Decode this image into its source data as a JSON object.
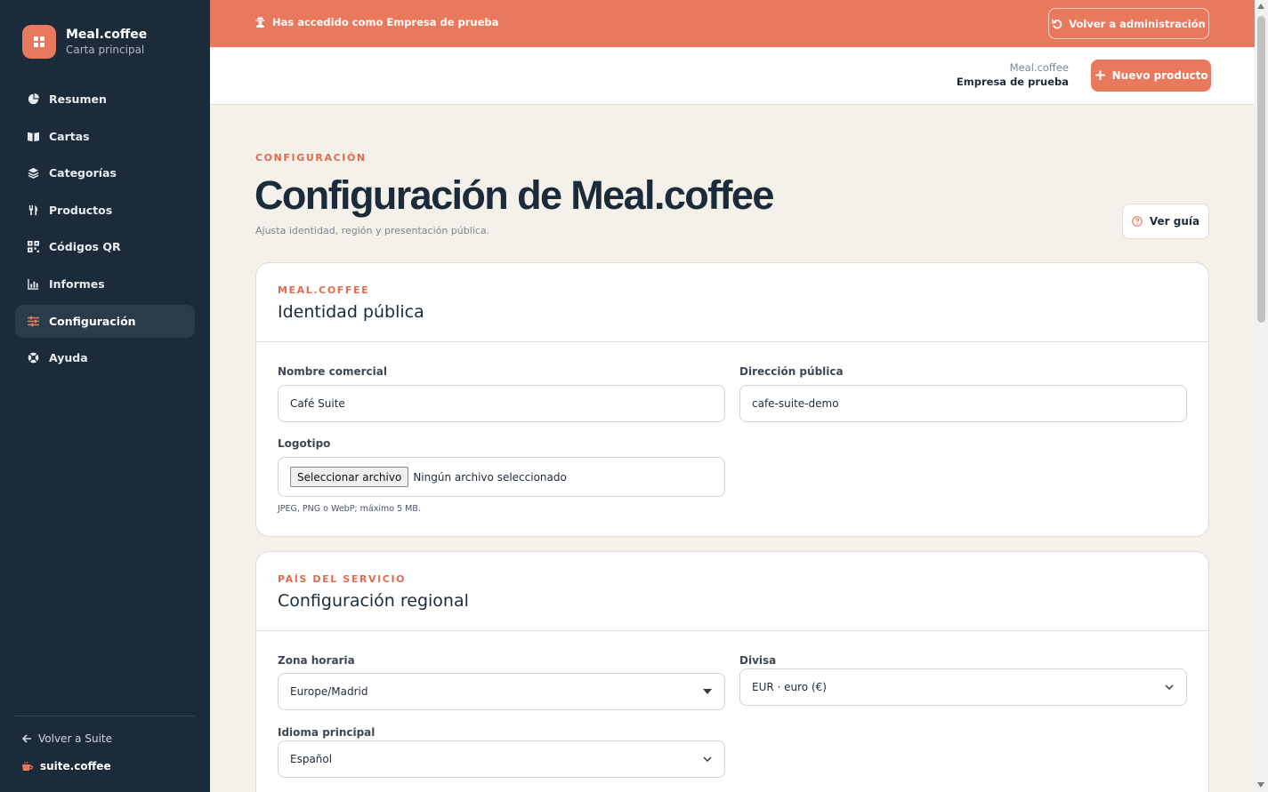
{
  "sidebar": {
    "brand_name": "Meal.coffee",
    "brand_subtitle": "Carta principal",
    "items": [
      {
        "label": "Resumen",
        "icon": "pie-chart-icon"
      },
      {
        "label": "Cartas",
        "icon": "book-open-icon"
      },
      {
        "label": "Categorías",
        "icon": "layers-icon"
      },
      {
        "label": "Productos",
        "icon": "utensils-icon"
      },
      {
        "label": "Códigos QR",
        "icon": "qr-code-icon"
      },
      {
        "label": "Informes",
        "icon": "bar-chart-icon"
      },
      {
        "label": "Configuración",
        "icon": "sliders-icon",
        "active": true
      },
      {
        "label": "Ayuda",
        "icon": "help-circle-icon"
      }
    ],
    "back_label": "Volver a Suite",
    "suite_brand": "suite.coffee"
  },
  "banner": {
    "text": "Has accedido como Empresa de prueba",
    "button_label": "Volver a administración"
  },
  "header": {
    "app_name": "Meal.coffee",
    "company": "Empresa de prueba",
    "new_product_label": "Nuevo producto"
  },
  "page": {
    "eyebrow": "CONFIGURACIÓN",
    "title": "Configuración de Meal.coffee",
    "subtitle": "Ajusta identidad, región y presentación pública.",
    "guide_label": "Ver guía"
  },
  "identity": {
    "eyebrow": "MEAL.COFFEE",
    "title": "Identidad pública",
    "trade_name_label": "Nombre comercial",
    "trade_name_value": "Café Suite",
    "public_address_label": "Dirección pública",
    "public_address_value": "cafe-suite-demo",
    "logo_label": "Logotipo",
    "file_button": "Seleccionar archivo",
    "file_status": "Ningún archivo seleccionado",
    "logo_hint": "JPEG, PNG o WebP; máximo 5 MB."
  },
  "regional": {
    "eyebrow": "PAÍS DEL SERVICIO",
    "title": "Configuración regional",
    "timezone_label": "Zona horaria",
    "timezone_value": "Europe/Madrid",
    "currency_label": "Divisa",
    "currency_value": "EUR · euro (€)",
    "language_label": "Idioma principal",
    "language_value": "Español"
  },
  "colors": {
    "accent": "#e8795d",
    "sidebar": "#1b2b3a",
    "background": "#f4f0ea"
  }
}
